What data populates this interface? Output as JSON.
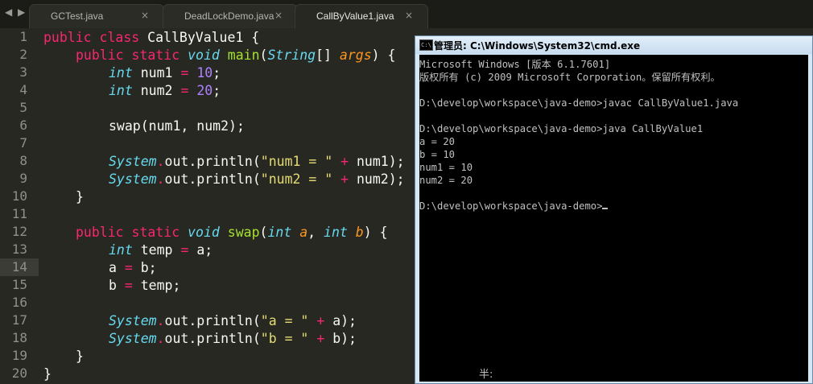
{
  "tabs": [
    {
      "label": "GCTest.java",
      "close": "×"
    },
    {
      "label": "DeadLockDemo.java",
      "close": "×"
    },
    {
      "label": "CallByValue1.java",
      "close": "×"
    }
  ],
  "nav": {
    "left": "◀",
    "right": "▶"
  },
  "editor": {
    "line_numbers": [
      "1",
      "2",
      "3",
      "4",
      "5",
      "6",
      "7",
      "8",
      "9",
      "10",
      "11",
      "12",
      "13",
      "14",
      "15",
      "16",
      "17",
      "18",
      "19",
      "20"
    ],
    "active_line": "14",
    "code": {
      "l1": {
        "kw1": "public",
        "kw2": "class",
        "name": "CallByValue1 {"
      },
      "l2": {
        "kw1": "public",
        "kw2": "static",
        "t": "void",
        "fn": "main",
        "p1": "(",
        "ty": "String",
        "p2": "[] ",
        "arg": "args",
        "p3": ") {"
      },
      "l3": {
        "t": "int",
        "v": "num1",
        "op": "=",
        "n": "10",
        "end": ";"
      },
      "l4": {
        "t": "int",
        "v": "num2",
        "op": "=",
        "n": "20",
        "end": ";"
      },
      "l6": {
        "text": "swap(num1, num2);"
      },
      "l8": {
        "cls": "System",
        "dot": ".",
        "rest": "out.println(",
        "s": "\"num1 = \"",
        "op": "+",
        "tail": "num1);"
      },
      "l9": {
        "cls": "System",
        "dot": ".",
        "rest": "out.println(",
        "s": "\"num2 = \"",
        "op": "+",
        "tail": "num2);"
      },
      "l10": {
        "text": "}"
      },
      "l12": {
        "kw1": "public",
        "kw2": "static",
        "t": "void",
        "fn": "swap",
        "p1": "(",
        "t2": "int",
        "a": "a",
        "c": ", ",
        "t3": "int",
        "b": "b",
        "p2": ") {"
      },
      "l13": {
        "t": "int",
        "v": "temp",
        "op": "=",
        "end": "a;"
      },
      "l14": {
        "v": "a",
        "op": "=",
        "end": "b;"
      },
      "l15": {
        "v": "b",
        "op": "=",
        "end": "temp;"
      },
      "l17": {
        "cls": "System",
        "dot": ".",
        "rest": "out.println(",
        "s": "\"a = \"",
        "op": "+",
        "tail": "a);"
      },
      "l18": {
        "cls": "System",
        "dot": ".",
        "rest": "out.println(",
        "s": "\"b = \"",
        "op": "+",
        "tail": "b);"
      },
      "l19": {
        "text": "}"
      },
      "l20": {
        "text": "}"
      }
    }
  },
  "cmd": {
    "icon": "C:\\",
    "title": "管理员: C:\\Windows\\System32\\cmd.exe",
    "lines": [
      "Microsoft Windows [版本 6.1.7601]",
      "版权所有 (c) 2009 Microsoft Corporation。保留所有权利。",
      "",
      "D:\\develop\\workspace\\java-demo>javac CallByValue1.java",
      "",
      "D:\\develop\\workspace\\java-demo>java CallByValue1",
      "a = 20",
      "b = 10",
      "num1 = 10",
      "num2 = 20",
      "",
      "D:\\develop\\workspace\\java-demo>"
    ],
    "ime_indicator": "半:"
  }
}
